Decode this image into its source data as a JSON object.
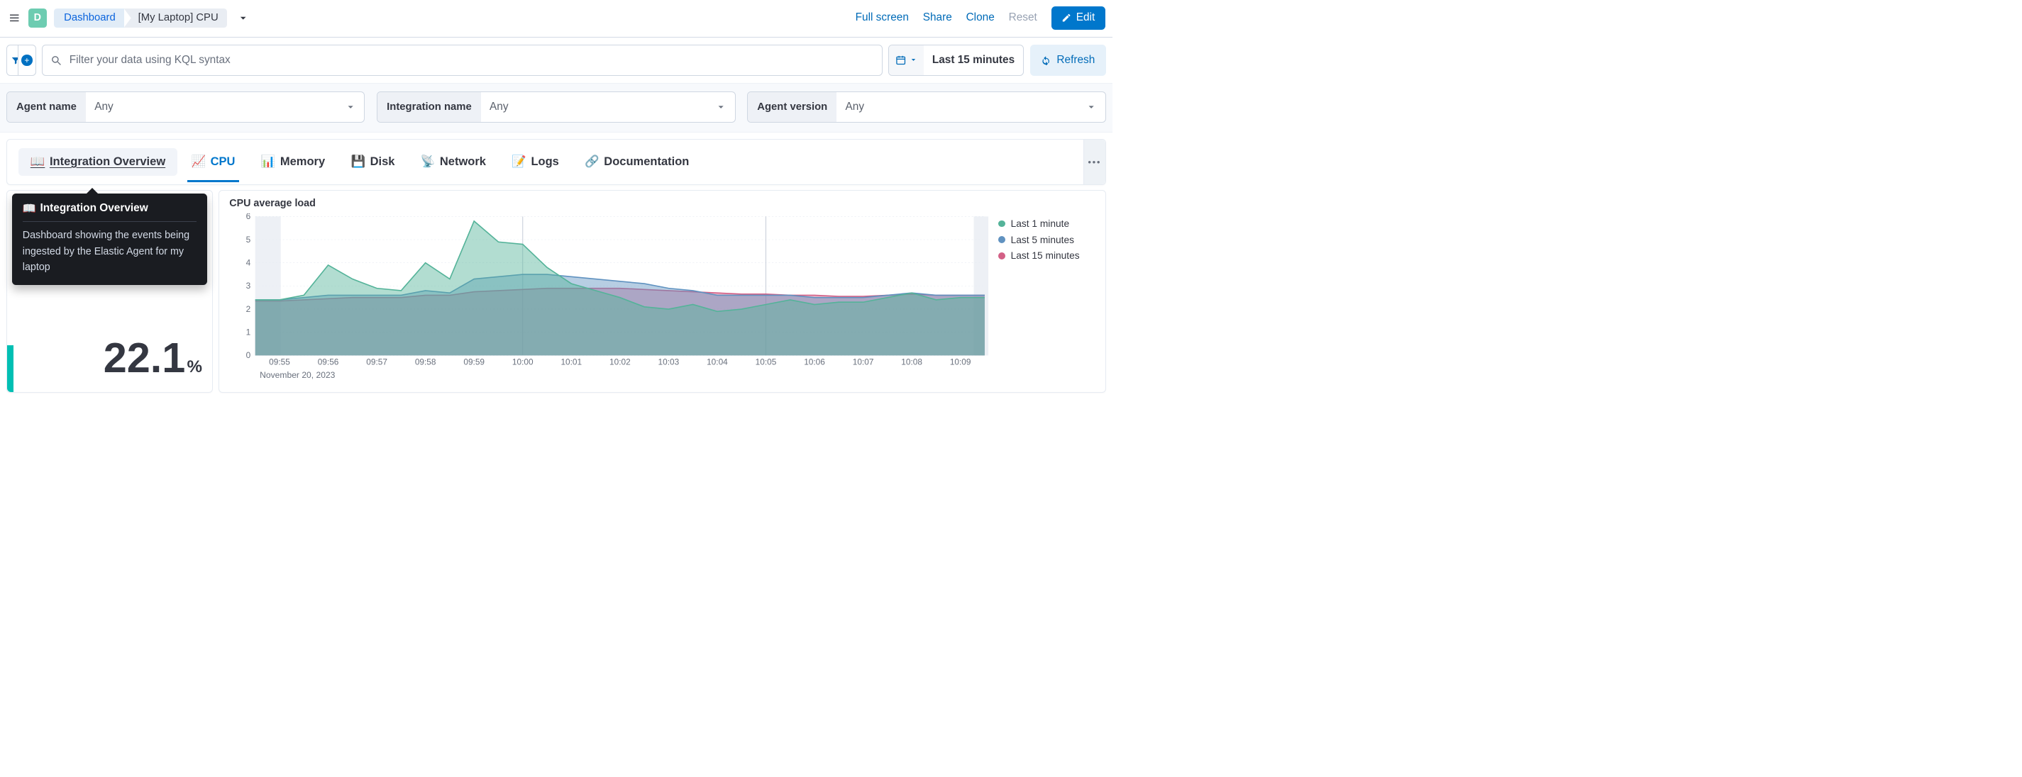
{
  "header": {
    "avatar_letter": "D",
    "breadcrumbs": {
      "root": "Dashboard",
      "leaf": "[My Laptop] CPU"
    },
    "actions": {
      "full_screen": "Full screen",
      "share": "Share",
      "clone": "Clone",
      "reset": "Reset",
      "edit": "Edit"
    }
  },
  "querybar": {
    "search_placeholder": "Filter your data using KQL syntax",
    "date_label": "Last 15 minutes",
    "refresh": "Refresh"
  },
  "filters": {
    "agent_name": {
      "label": "Agent name",
      "value": "Any"
    },
    "integration_name": {
      "label": "Integration name",
      "value": "Any"
    },
    "agent_version": {
      "label": "Agent version",
      "value": "Any"
    }
  },
  "tabs": [
    {
      "icon": "📖",
      "label": "Integration Overview"
    },
    {
      "icon": "📈",
      "label": "CPU"
    },
    {
      "icon": "📊",
      "label": "Memory"
    },
    {
      "icon": "💾",
      "label": "Disk"
    },
    {
      "icon": "📡",
      "label": "Network"
    },
    {
      "icon": "📝",
      "label": "Logs"
    },
    {
      "icon": "🔗",
      "label": "Documentation"
    }
  ],
  "tooltip": {
    "title_icon": "📖",
    "title": "Integration Overview",
    "body": "Dashboard showing the events being ingested by the Elastic Agent for my laptop"
  },
  "metric": {
    "value": "22.1",
    "suffix": "%"
  },
  "chart": {
    "title": "CPU average load",
    "date_label": "November 20, 2023",
    "legend": [
      {
        "label": "Last 1 minute",
        "color": "#54b399"
      },
      {
        "label": "Last 5 minutes",
        "color": "#6092c0"
      },
      {
        "label": "Last 15 minutes",
        "color": "#d36086"
      }
    ]
  },
  "chart_data": {
    "type": "line",
    "title": "CPU average load",
    "ylabel": "",
    "xlabel": "November 20, 2023",
    "ylim": [
      0,
      6
    ],
    "x": [
      "09:54.5",
      "09:55",
      "09:55.5",
      "09:56",
      "09:56.5",
      "09:57",
      "09:57.5",
      "09:58",
      "09:58.5",
      "09:59",
      "09:59.5",
      "10:00",
      "10:00.5",
      "10:01",
      "10:01.5",
      "10:02",
      "10:02.5",
      "10:03",
      "10:03.5",
      "10:04",
      "10:04.5",
      "10:05",
      "10:05.5",
      "10:06",
      "10:06.5",
      "10:07",
      "10:07.5",
      "10:08",
      "10:08.5",
      "10:09",
      "10:09.5"
    ],
    "x_ticks": [
      "09:55",
      "09:56",
      "09:57",
      "09:58",
      "09:59",
      "10:00",
      "10:01",
      "10:02",
      "10:03",
      "10:04",
      "10:05",
      "10:06",
      "10:07",
      "10:08",
      "10:09"
    ],
    "series": [
      {
        "name": "Last 1 minute",
        "color": "#54b399",
        "values": [
          2.4,
          2.4,
          2.6,
          3.9,
          3.3,
          2.9,
          2.8,
          4.0,
          3.3,
          5.8,
          4.9,
          4.8,
          3.8,
          3.1,
          2.8,
          2.5,
          2.1,
          2.0,
          2.2,
          1.9,
          2.0,
          2.2,
          2.4,
          2.2,
          2.3,
          2.3,
          2.5,
          2.7,
          2.4,
          2.5,
          2.5
        ]
      },
      {
        "name": "Last 5 minutes",
        "color": "#6092c0",
        "values": [
          2.4,
          2.4,
          2.5,
          2.6,
          2.6,
          2.6,
          2.6,
          2.8,
          2.7,
          3.3,
          3.4,
          3.5,
          3.5,
          3.4,
          3.3,
          3.2,
          3.1,
          2.9,
          2.8,
          2.6,
          2.6,
          2.6,
          2.6,
          2.5,
          2.5,
          2.5,
          2.6,
          2.7,
          2.6,
          2.6,
          2.6
        ]
      },
      {
        "name": "Last 15 minutes",
        "color": "#d36086",
        "values": [
          2.35,
          2.35,
          2.4,
          2.45,
          2.5,
          2.5,
          2.5,
          2.6,
          2.6,
          2.75,
          2.8,
          2.85,
          2.9,
          2.9,
          2.9,
          2.9,
          2.85,
          2.8,
          2.75,
          2.7,
          2.65,
          2.65,
          2.6,
          2.6,
          2.55,
          2.55,
          2.6,
          2.65,
          2.6,
          2.6,
          2.6
        ]
      }
    ],
    "vlines_at": [
      "09:59.8",
      "10:04.8"
    ]
  }
}
